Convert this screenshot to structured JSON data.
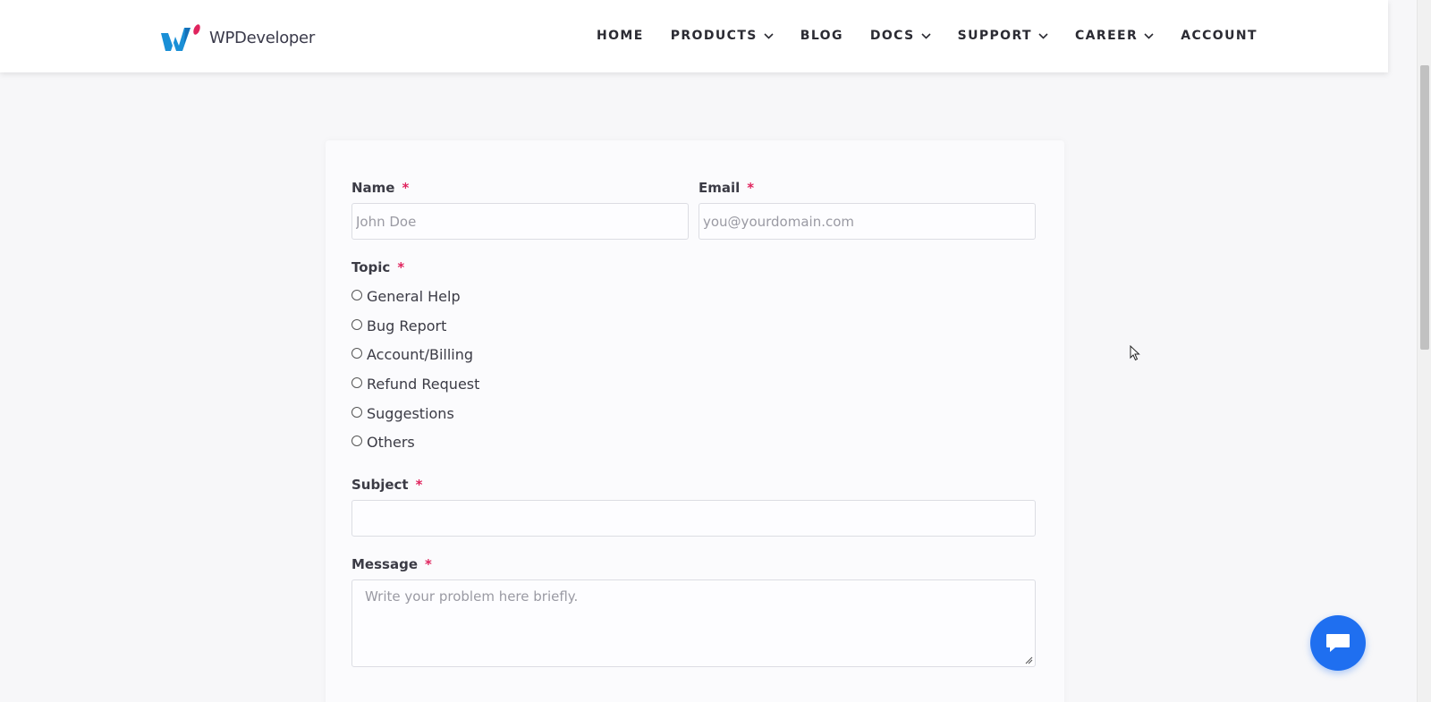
{
  "header": {
    "logo_text": "WPDeveloper",
    "nav": [
      {
        "label": "HOME",
        "has_dropdown": false
      },
      {
        "label": "PRODUCTS",
        "has_dropdown": true
      },
      {
        "label": "BLOG",
        "has_dropdown": false
      },
      {
        "label": "DOCS",
        "has_dropdown": true
      },
      {
        "label": "SUPPORT",
        "has_dropdown": true
      },
      {
        "label": "CAREER",
        "has_dropdown": true
      },
      {
        "label": "ACCOUNT",
        "has_dropdown": false
      }
    ]
  },
  "form": {
    "required_mark": "*",
    "name": {
      "label": "Name",
      "placeholder": "John Doe",
      "value": ""
    },
    "email": {
      "label": "Email",
      "placeholder": "you@yourdomain.com",
      "value": ""
    },
    "topic": {
      "label": "Topic",
      "options": [
        "General Help",
        "Bug Report",
        "Account/Billing",
        "Refund Request",
        "Suggestions",
        "Others"
      ],
      "selected": null
    },
    "subject": {
      "label": "Subject",
      "placeholder": "",
      "value": ""
    },
    "message": {
      "label": "Message",
      "placeholder": "Write your problem here briefly.",
      "value": ""
    }
  },
  "icons": {
    "chat": "chat-bubble-icon",
    "dropdown": "chevron-down-icon",
    "cursor": "mouse-pointer-icon"
  },
  "colors": {
    "required": "#e0245e",
    "chat_button": "#1f6ff0",
    "logo_blue": "#1a8fd6",
    "logo_pink": "#e0245e"
  }
}
